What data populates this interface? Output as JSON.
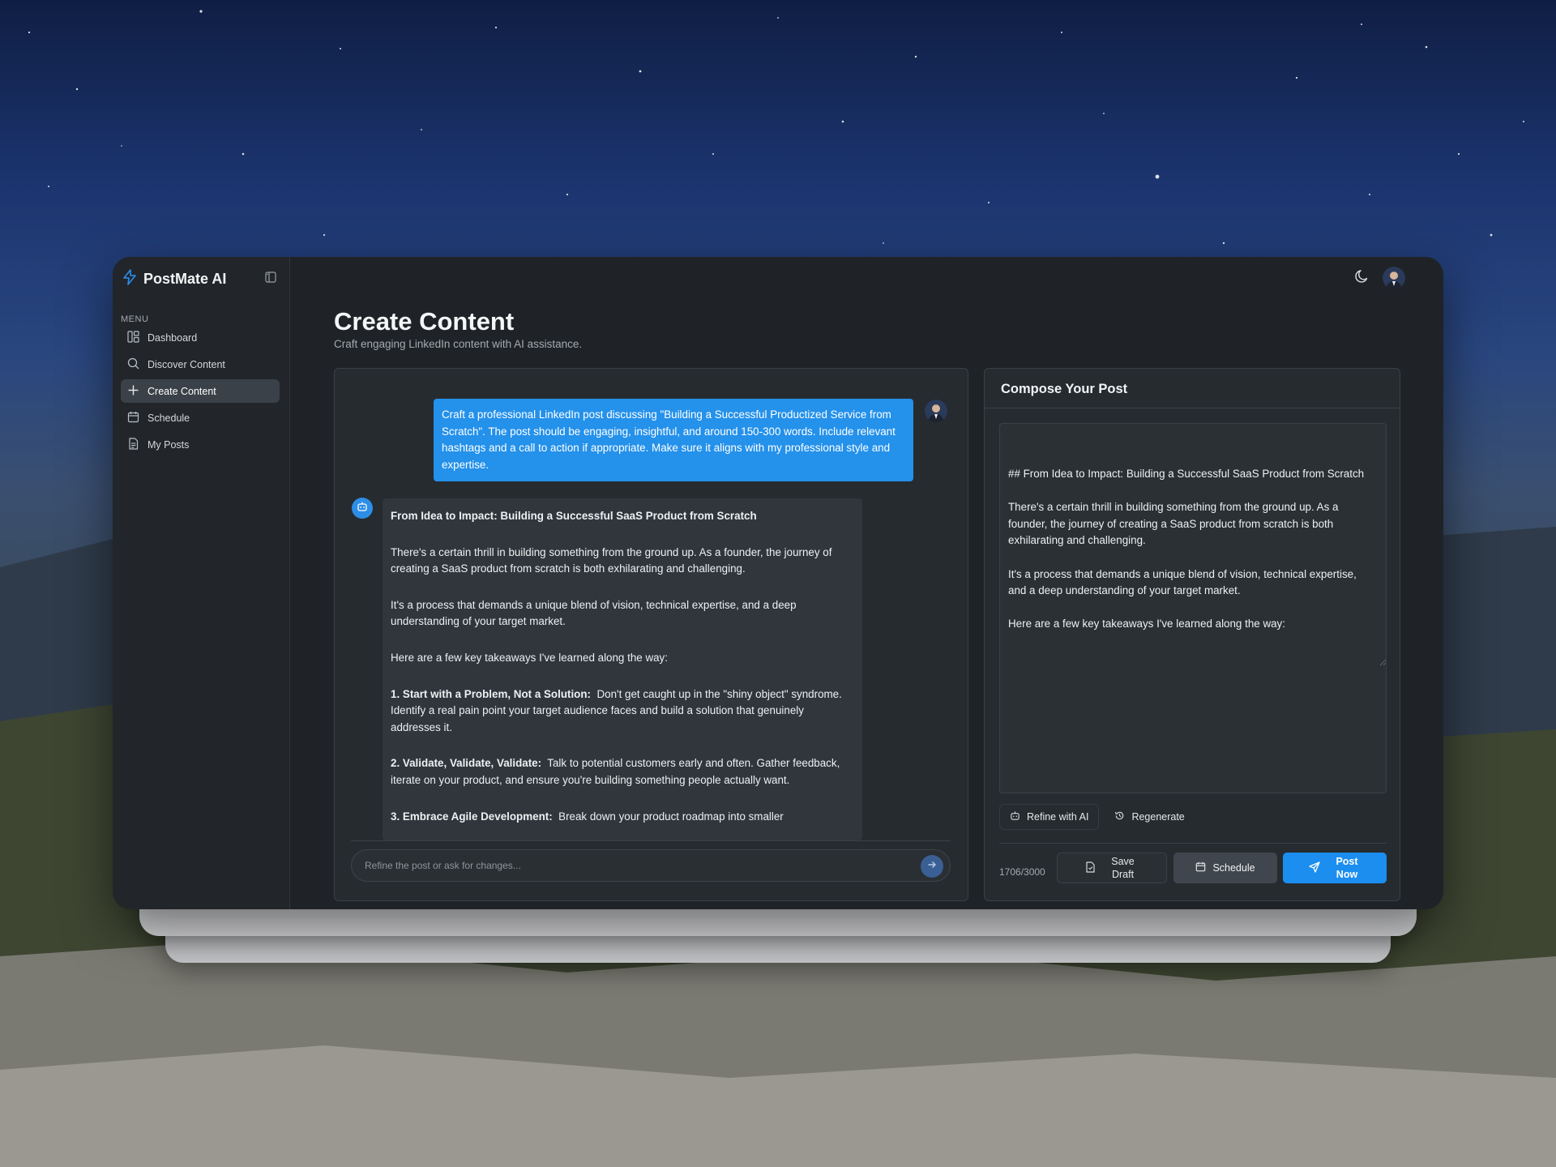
{
  "app": {
    "name": "PostMate AI"
  },
  "sidebar": {
    "menu_label": "MENU",
    "items": [
      {
        "label": "Dashboard",
        "icon": "dashboard-icon",
        "active": false
      },
      {
        "label": "Discover Content",
        "icon": "search-icon",
        "active": false
      },
      {
        "label": "Create Content",
        "icon": "plus-icon",
        "active": true
      },
      {
        "label": "Schedule",
        "icon": "calendar-icon",
        "active": false
      },
      {
        "label": "My Posts",
        "icon": "document-icon",
        "active": false
      }
    ]
  },
  "header": {
    "title": "Create Content",
    "subtitle": "Craft engaging LinkedIn content with AI assistance."
  },
  "chat": {
    "user_message": "Craft a professional LinkedIn post discussing \"Building a Successful Productized Service from Scratch\". The post should be engaging, insightful, and around 150-300 words. Include relevant hashtags and a call to action if appropriate. Make sure it aligns with my professional style and expertise.",
    "bot_title": "From Idea to Impact: Building a Successful SaaS Product from Scratch",
    "bot_p1": "There's a certain thrill in building something from the ground up.  As a founder, the journey of creating a SaaS product from scratch is both exhilarating and challenging.",
    "bot_p2": "It's a process that demands a unique blend of vision, technical expertise, and a deep understanding of your target market.",
    "bot_p3": "Here are a few key takeaways I've learned along the way:",
    "point1_title": "1.  Start with a Problem, Not a Solution:",
    "point1_body": "Don't get caught up in the \"shiny object\" syndrome. Identify a real pain point your target audience faces and build a solution that genuinely addresses it.",
    "point2_title": "2.  Validate, Validate, Validate:",
    "point2_body": "Talk to potential customers early and often.  Gather feedback, iterate on your product, and ensure you're building something people actually want.",
    "point3_title": "3.  Embrace Agile Development:",
    "point3_body": "Break down your product roadmap into smaller",
    "input_placeholder": "Refine the post or ask for changes..."
  },
  "compose": {
    "title": "Compose Your Post",
    "line1": "## From Idea to Impact: Building a Successful SaaS Product from Scratch",
    "line2": "There's a certain thrill in building something from the ground up.  As a founder, the journey of creating a SaaS product from scratch is both exhilarating and challenging.",
    "line3": "It's a process that demands a unique blend of vision, technical expertise, and a deep understanding of your target market.",
    "line4": "Here are a few key takeaways I've learned along the way:",
    "refine_label": "Refine with AI",
    "regenerate_label": "Regenerate",
    "char_count": "1706/3000",
    "save_draft_label": "Save Draft",
    "schedule_label": "Schedule",
    "post_now_label": "Post Now"
  },
  "colors": {
    "accent": "#1b8ef0",
    "user_bubble": "#2491eb",
    "window_bg": "#1f2327"
  }
}
